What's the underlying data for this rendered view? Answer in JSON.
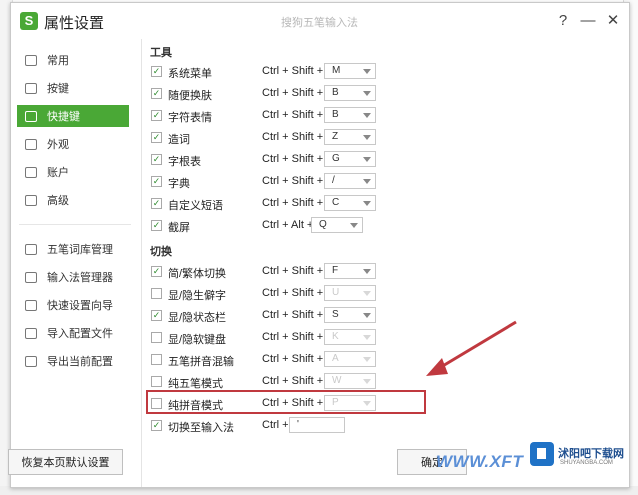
{
  "window": {
    "logo": "S",
    "title": "属性设置",
    "watermark_title": "搜狗五笔输入法",
    "help": "?",
    "minimize": "—",
    "close": "✕"
  },
  "sidebar": {
    "items": [
      {
        "label": "常用",
        "icon": "monitor-icon"
      },
      {
        "label": "按键",
        "icon": "image-icon"
      },
      {
        "label": "快捷键",
        "icon": "shortcut-icon",
        "active": true
      },
      {
        "label": "外观",
        "icon": "shirt-icon"
      },
      {
        "label": "账户",
        "icon": "user-icon"
      },
      {
        "label": "高级",
        "icon": "advanced-icon"
      }
    ],
    "tools": [
      {
        "label": "五笔词库管理",
        "icon": "dictionary-icon"
      },
      {
        "label": "输入法管理器",
        "icon": "manager-icon"
      },
      {
        "label": "快速设置向导",
        "icon": "flag-icon"
      },
      {
        "label": "导入配置文件",
        "icon": "import-icon"
      },
      {
        "label": "导出当前配置",
        "icon": "export-icon"
      }
    ]
  },
  "sections": {
    "tools": {
      "title": "工具",
      "rows": [
        {
          "label": "系统菜单",
          "keys": "Ctrl + Shift +",
          "value": "M",
          "checked": true
        },
        {
          "label": "随便换肤",
          "keys": "Ctrl + Shift +",
          "value": "B",
          "checked": true
        },
        {
          "label": "字符表情",
          "keys": "Ctrl + Shift +",
          "value": "B",
          "checked": true
        },
        {
          "label": "造词",
          "keys": "Ctrl + Shift +",
          "value": "Z",
          "checked": true
        },
        {
          "label": "字根表",
          "keys": "Ctrl + Shift +",
          "value": "G",
          "checked": true
        },
        {
          "label": "字典",
          "keys": "Ctrl + Shift +",
          "value": "/",
          "checked": true
        },
        {
          "label": "自定义短语",
          "keys": "Ctrl + Shift +",
          "value": "C",
          "checked": true
        },
        {
          "label": "截屏",
          "keys": "Ctrl + Alt +",
          "value": "Q",
          "checked": true
        }
      ]
    },
    "switch": {
      "title": "切换",
      "rows": [
        {
          "label": "简/繁体切换",
          "keys": "Ctrl + Shift +",
          "value": "F",
          "checked": true
        },
        {
          "label": "显/隐生僻字",
          "keys": "Ctrl + Shift +",
          "value": "U",
          "checked": false
        },
        {
          "label": "显/隐状态栏",
          "keys": "Ctrl + Shift +",
          "value": "S",
          "checked": true
        },
        {
          "label": "显/隐软键盘",
          "keys": "Ctrl + Shift +",
          "value": "K",
          "checked": false
        },
        {
          "label": "五笔拼音混输",
          "keys": "Ctrl + Shift +",
          "value": "A",
          "checked": false
        },
        {
          "label": "纯五笔模式",
          "keys": "Ctrl + Shift +",
          "value": "W",
          "checked": false
        },
        {
          "label": "纯拼音模式",
          "keys": "Ctrl + Shift +",
          "value": "P",
          "checked": false
        },
        {
          "label": "切换至输入法",
          "keys": "Ctrl +",
          "value": "'",
          "checked": true
        }
      ]
    }
  },
  "footer": {
    "reset_label": "恢复本页默认设置",
    "ok_label": "确定"
  },
  "watermark": {
    "url": "WWW.XFT",
    "brand": "沭阳吧下载网",
    "brand_sub": "SHUYANGBA.COM"
  },
  "colors": {
    "accent": "#4aa836",
    "highlight": "#c0393f"
  }
}
